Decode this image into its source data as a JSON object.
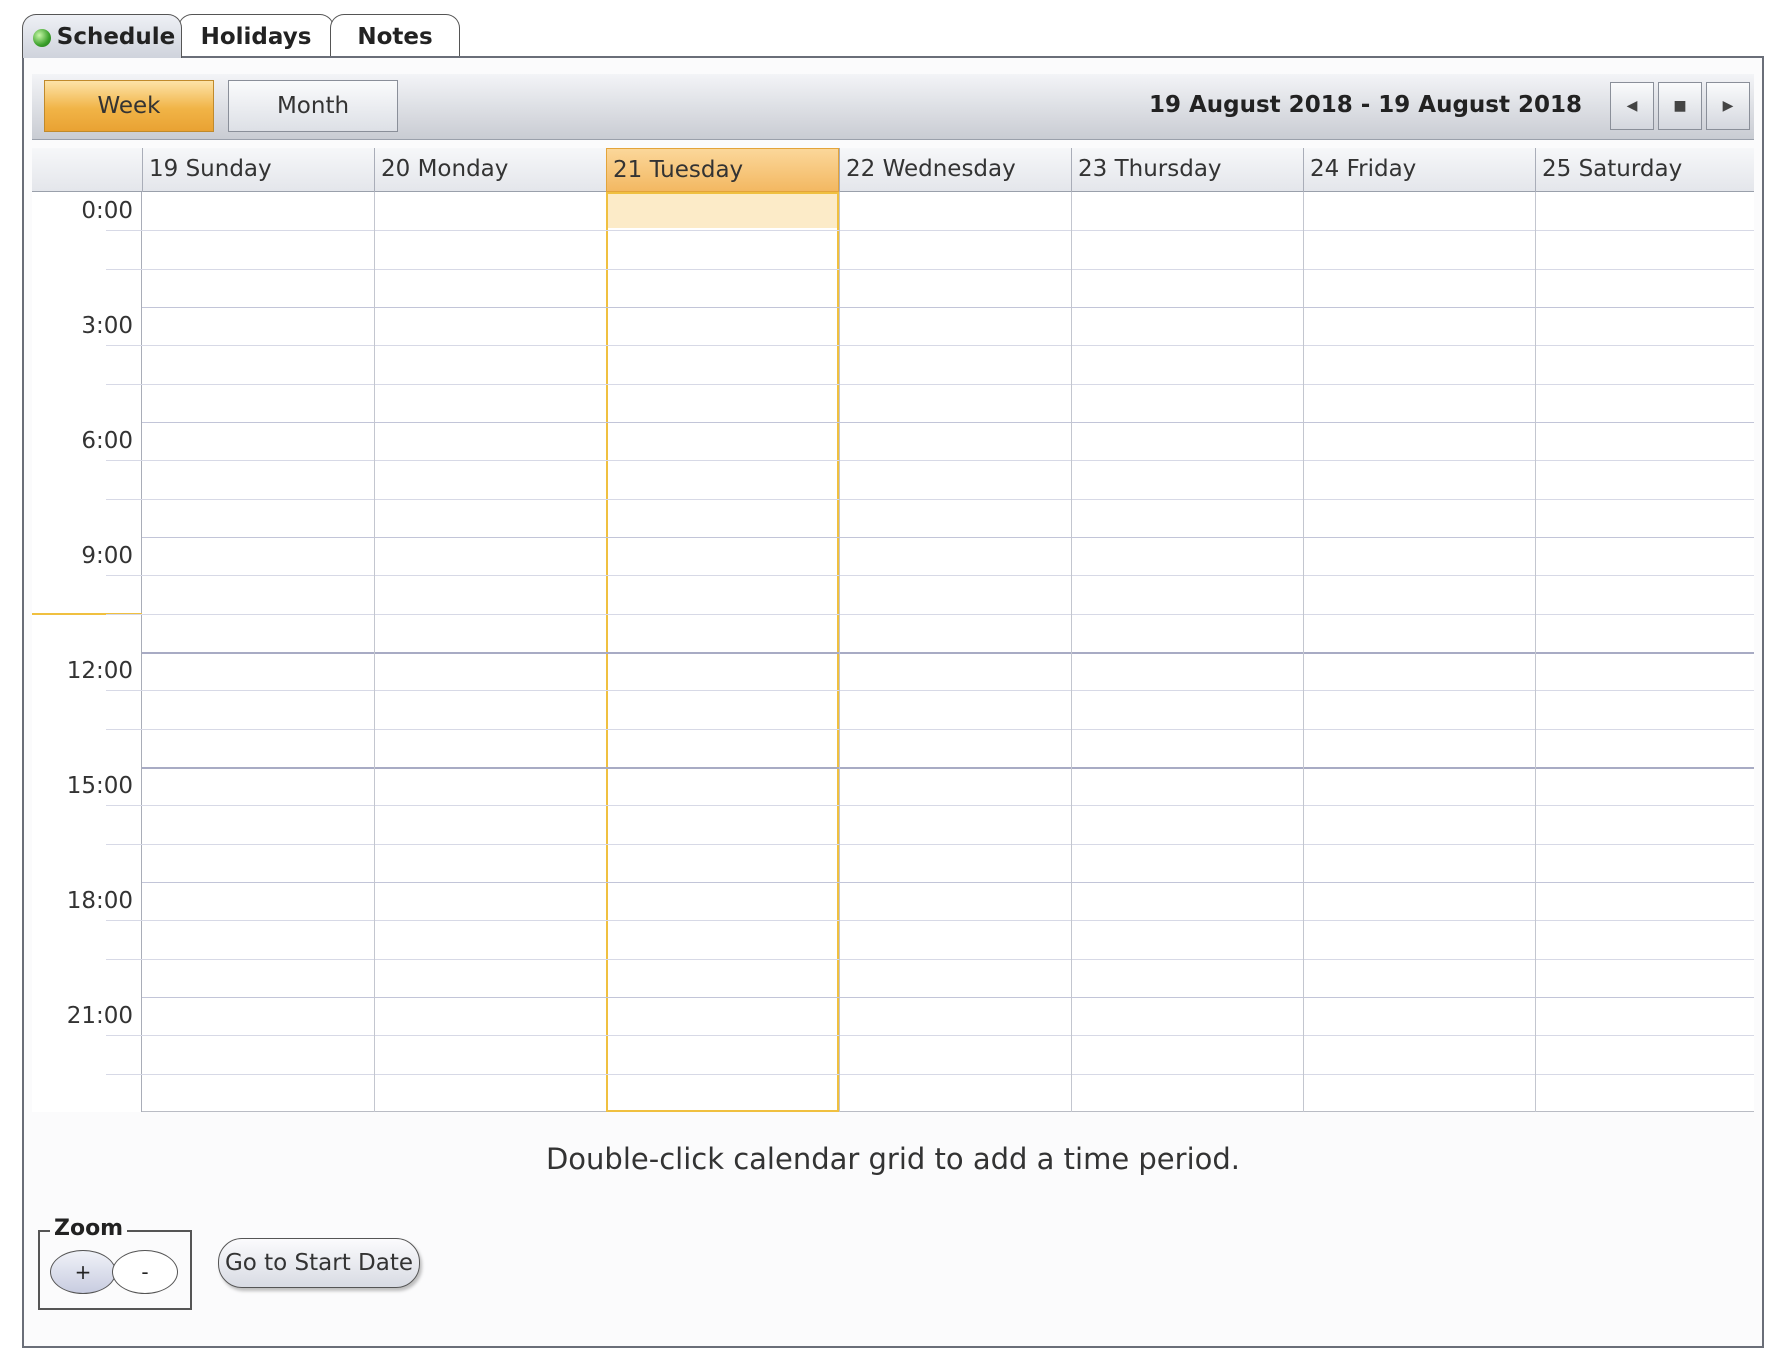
{
  "tabs": [
    {
      "label": "Schedule",
      "active": true
    },
    {
      "label": "Holidays",
      "active": false
    },
    {
      "label": "Notes",
      "active": false
    }
  ],
  "toolbar": {
    "week_label": "Week",
    "month_label": "Month",
    "date_range": "19 August 2018 - 19 August 2018",
    "prev_icon": "chevron-left-icon",
    "today_icon": "square-icon",
    "next_icon": "chevron-right-icon"
  },
  "days": [
    {
      "label": "19 Sunday",
      "today": false
    },
    {
      "label": "20 Monday",
      "today": false
    },
    {
      "label": "21 Tuesday",
      "today": true
    },
    {
      "label": "22 Wednesday",
      "today": false
    },
    {
      "label": "23 Thursday",
      "today": false
    },
    {
      "label": "24 Friday",
      "today": false
    },
    {
      "label": "25 Saturday",
      "today": false
    }
  ],
  "times": [
    "0:00",
    "3:00",
    "6:00",
    "9:00",
    "12:00",
    "15:00",
    "18:00",
    "21:00"
  ],
  "hint": "Double-click calendar grid to add a time period.",
  "zoom": {
    "title": "Zoom",
    "plus": "+",
    "minus": "-"
  },
  "goto_label": "Go to Start Date",
  "colors": {
    "accent": "#f0c040",
    "today_header": "#f3b862"
  }
}
